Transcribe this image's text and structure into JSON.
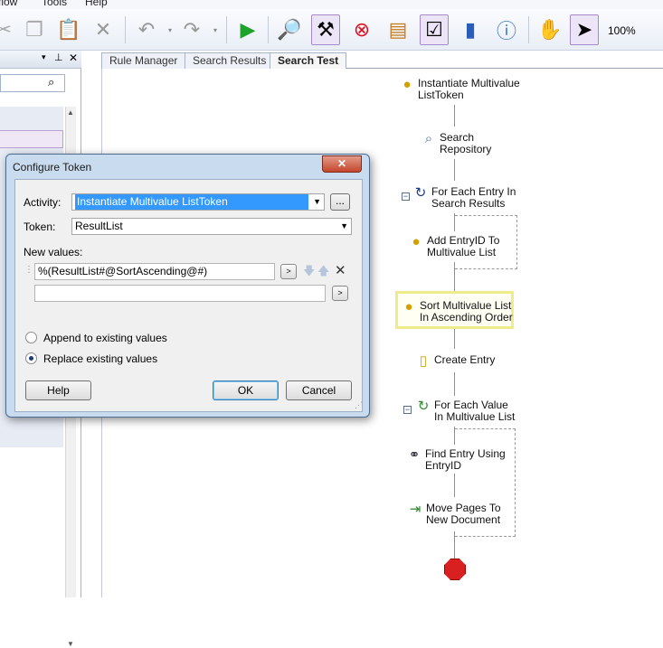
{
  "menu": {
    "items": [
      "rflow",
      "Tools",
      "Help"
    ]
  },
  "toolbar": {
    "zoom": "100%"
  },
  "tabs": [
    "Rule Manager",
    "Search Results",
    "Search Test"
  ],
  "workflow": {
    "activities": [
      {
        "line1": "Instantiate Multivalue",
        "line2": "ListToken"
      },
      {
        "line1": "Search",
        "line2": "Repository"
      },
      {
        "line1": "For Each Entry In",
        "line2": "Search Results"
      },
      {
        "line1": "Add EntryID To",
        "line2": "Multivalue List"
      },
      {
        "line1": "Sort Multivalue List",
        "line2": "In Ascending Order"
      },
      {
        "line1": "Create Entry",
        "line2": ""
      },
      {
        "line1": "For Each Value",
        "line2": "In Multivalue List"
      },
      {
        "line1": "Find Entry Using",
        "line2": "EntryID"
      },
      {
        "line1": "Move Pages To",
        "line2": "New Document"
      }
    ]
  },
  "dialog": {
    "title": "Configure Token",
    "close_glyph": "✕",
    "activity_label": "Activity:",
    "activity_value": "Instantiate Multivalue ListToken",
    "browse_label": "...",
    "token_label": "Token:",
    "token_value": "ResultList",
    "new_values_label": "New values:",
    "value1": "%(ResultList#@SortAscending@#)",
    "value2": "",
    "token_button": ">",
    "append_label": "Append to existing values",
    "replace_label": "Replace existing values",
    "help_label": "Help",
    "ok_label": "OK",
    "cancel_label": "Cancel"
  }
}
